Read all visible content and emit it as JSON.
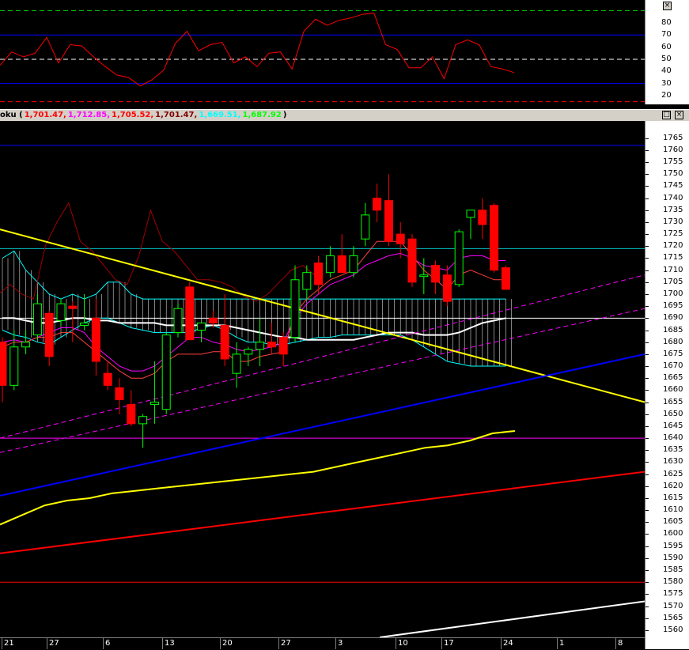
{
  "indicator_panel": {
    "y_ticks": [
      "80",
      "70",
      "60",
      "50",
      "40",
      "30",
      "20"
    ],
    "level_lines": [
      {
        "value": 90,
        "color": "#00c000",
        "style": "dashed"
      },
      {
        "value": 70,
        "color": "#0000ff",
        "style": "solid"
      },
      {
        "value": 50,
        "color": "#ffffff",
        "style": "dashed"
      },
      {
        "value": 30,
        "color": "#0000ff",
        "style": "solid"
      },
      {
        "value": 15,
        "color": "#ff0000",
        "style": "dashed"
      }
    ],
    "series_color": "#ff0000"
  },
  "main_title": {
    "prefix": "oku (",
    "values": [
      {
        "text": "1,701.47,",
        "color": "#ff0000"
      },
      {
        "text": "1,712.85,",
        "color": "#ff00ff"
      },
      {
        "text": "1,705.52,",
        "color": "#ff0000"
      },
      {
        "text": "1,701.47,",
        "color": "#800000"
      },
      {
        "text": "1,669.51,",
        "color": "#00ffff"
      },
      {
        "text": "1,687.92",
        "color": "#00ff00"
      }
    ],
    "suffix": ")",
    "buttons": [
      "□",
      "×"
    ]
  },
  "top_buttons": [
    "×"
  ],
  "x_axis_labels": [
    "21",
    "27",
    "6",
    "13",
    "20",
    "27",
    "3",
    "10",
    "17",
    "24",
    "1",
    "8"
  ],
  "colors": {
    "bull": "#00ff00",
    "bear": "#ff0000",
    "cloud": "#ffffff",
    "trend_down": "#ffff00",
    "channel": "#ff00ff",
    "support_blue": "#0000ff",
    "ma_yellow": "#ffff00",
    "ma_red": "#ff0000"
  },
  "chart_data": [
    {
      "type": "line",
      "title": "",
      "ylim": [
        15,
        90
      ],
      "y_ticks": [
        20,
        30,
        40,
        50,
        60,
        70,
        80
      ],
      "series": [
        {
          "values": [
            45,
            56,
            52,
            55,
            68,
            47,
            62,
            61,
            52,
            44,
            37,
            35,
            28,
            33,
            41,
            63,
            73,
            57,
            62,
            64,
            47,
            52,
            44,
            55,
            56,
            42,
            73,
            83,
            78,
            82,
            84,
            87,
            88,
            62,
            58,
            43,
            43,
            52,
            34,
            62,
            66,
            62,
            44,
            42,
            39
          ]
        }
      ]
    },
    {
      "type": "candlestick",
      "title": "",
      "ylim": [
        1557,
        1768
      ],
      "y_ticks": [
        1560,
        1565,
        1570,
        1575,
        1580,
        1585,
        1590,
        1595,
        1600,
        1605,
        1610,
        1615,
        1620,
        1625,
        1630,
        1635,
        1640,
        1645,
        1650,
        1655,
        1660,
        1665,
        1670,
        1675,
        1680,
        1685,
        1690,
        1695,
        1700,
        1705,
        1710,
        1715,
        1720,
        1725,
        1730,
        1735,
        1740,
        1745,
        1750,
        1755,
        1760,
        1765
      ],
      "x_tick_labels": [
        "21",
        "27",
        "6",
        "13",
        "20",
        "27",
        "3",
        "10",
        "17",
        "24",
        "1",
        "8"
      ],
      "candles": [
        {
          "o": 1680,
          "h": 1682,
          "l": 1655,
          "c": 1662
        },
        {
          "o": 1662,
          "h": 1685,
          "l": 1660,
          "c": 1678
        },
        {
          "o": 1678,
          "h": 1685,
          "l": 1675,
          "c": 1680
        },
        {
          "o": 1683,
          "h": 1700,
          "l": 1681,
          "c": 1696
        },
        {
          "o": 1692,
          "h": 1693,
          "l": 1670,
          "c": 1674
        },
        {
          "o": 1689,
          "h": 1698,
          "l": 1687,
          "c": 1696
        },
        {
          "o": 1695,
          "h": 1697,
          "l": 1680,
          "c": 1694
        },
        {
          "o": 1687,
          "h": 1700,
          "l": 1685,
          "c": 1688
        },
        {
          "o": 1690,
          "h": 1698,
          "l": 1666,
          "c": 1672
        },
        {
          "o": 1667,
          "h": 1672,
          "l": 1660,
          "c": 1662
        },
        {
          "o": 1661,
          "h": 1665,
          "l": 1650,
          "c": 1656
        },
        {
          "o": 1654,
          "h": 1660,
          "l": 1645,
          "c": 1646
        },
        {
          "o": 1646,
          "h": 1650,
          "l": 1636,
          "c": 1649
        },
        {
          "o": 1654,
          "h": 1672,
          "l": 1646,
          "c": 1655
        },
        {
          "o": 1652,
          "h": 1684,
          "l": 1650,
          "c": 1683
        },
        {
          "o": 1684,
          "h": 1696,
          "l": 1682,
          "c": 1694
        },
        {
          "o": 1703,
          "h": 1705,
          "l": 1682,
          "c": 1681
        },
        {
          "o": 1685,
          "h": 1688,
          "l": 1680,
          "c": 1688
        },
        {
          "o": 1690,
          "h": 1693,
          "l": 1686,
          "c": 1688
        },
        {
          "o": 1687,
          "h": 1700,
          "l": 1670,
          "c": 1673
        },
        {
          "o": 1667,
          "h": 1680,
          "l": 1661,
          "c": 1675
        },
        {
          "o": 1675,
          "h": 1678,
          "l": 1670,
          "c": 1677
        },
        {
          "o": 1677,
          "h": 1690,
          "l": 1670,
          "c": 1680
        },
        {
          "o": 1680,
          "h": 1688,
          "l": 1675,
          "c": 1678
        },
        {
          "o": 1682,
          "h": 1684,
          "l": 1670,
          "c": 1675
        },
        {
          "o": 1682,
          "h": 1712,
          "l": 1680,
          "c": 1706
        },
        {
          "o": 1702,
          "h": 1712,
          "l": 1698,
          "c": 1709
        },
        {
          "o": 1713,
          "h": 1716,
          "l": 1700,
          "c": 1704
        },
        {
          "o": 1709,
          "h": 1720,
          "l": 1707,
          "c": 1716
        },
        {
          "o": 1716,
          "h": 1725,
          "l": 1709,
          "c": 1709
        },
        {
          "o": 1709,
          "h": 1720,
          "l": 1707,
          "c": 1716
        },
        {
          "o": 1723,
          "h": 1738,
          "l": 1720,
          "c": 1733
        },
        {
          "o": 1740,
          "h": 1746,
          "l": 1730,
          "c": 1735
        },
        {
          "o": 1739,
          "h": 1750,
          "l": 1720,
          "c": 1722
        },
        {
          "o": 1725,
          "h": 1730,
          "l": 1715,
          "c": 1721
        },
        {
          "o": 1723,
          "h": 1725,
          "l": 1703,
          "c": 1705
        },
        {
          "o": 1708,
          "h": 1715,
          "l": 1700,
          "c": 1708
        },
        {
          "o": 1712,
          "h": 1714,
          "l": 1700,
          "c": 1705
        },
        {
          "o": 1708,
          "h": 1712,
          "l": 1695,
          "c": 1697
        },
        {
          "o": 1704,
          "h": 1727,
          "l": 1703,
          "c": 1726
        },
        {
          "o": 1732,
          "h": 1735,
          "l": 1723,
          "c": 1735
        },
        {
          "o": 1735,
          "h": 1740,
          "l": 1723,
          "c": 1729
        },
        {
          "o": 1737,
          "h": 1738,
          "l": 1709,
          "c": 1710
        },
        {
          "o": 1711,
          "h": 1712,
          "l": 1702,
          "c": 1702
        }
      ]
    }
  ]
}
